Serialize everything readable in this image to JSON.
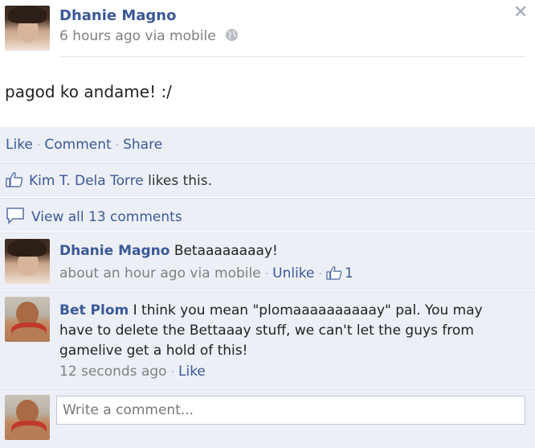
{
  "post": {
    "author": "Dhanie Magno",
    "time": "6 hours ago via mobile",
    "status": "pagod ko andame! :/"
  },
  "actions": {
    "like": "Like",
    "comment": "Comment",
    "share": "Share"
  },
  "likes": {
    "name": "Kim T. Dela Torre",
    "suffix": "likes this."
  },
  "view_all": "View all 13 comments",
  "comments": [
    {
      "author": "Dhanie Magno",
      "text": "Betaaaaaaaay!",
      "time": "about an hour ago via mobile",
      "unlike": "Unlike",
      "like_count": "1"
    },
    {
      "author": "Bet Plom",
      "text": "I think you mean \"plomaaaaaaaaaay\" pal. You may have to delete the Bettaaay stuff, we can't let the guys from gamelive get a hold of this!",
      "time": "12 seconds ago",
      "like": "Like"
    }
  ],
  "input": {
    "placeholder": "Write a comment..."
  },
  "icons": {
    "close": "close-icon",
    "globe": "globe-icon",
    "thumb": "thumbs-up-icon",
    "comment": "comment-bubble-icon"
  },
  "colors": {
    "link": "#3b5998",
    "band": "#eceff5",
    "meta": "#808080"
  }
}
